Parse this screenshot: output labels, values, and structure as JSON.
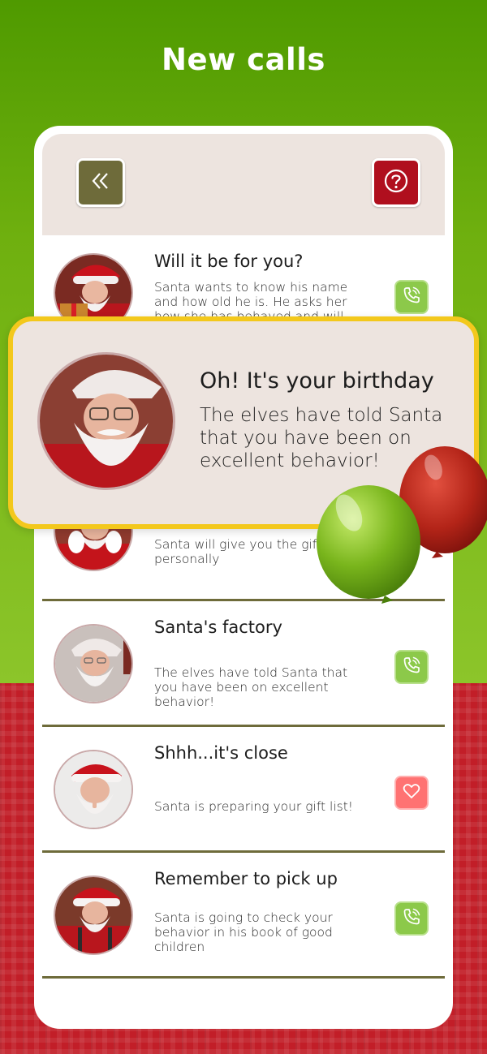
{
  "header": {
    "title": "New calls"
  },
  "toolbar": {
    "back_icon": "double-chevron-left-icon",
    "help_icon": "question-circle-icon"
  },
  "calls": [
    {
      "title": "Will it be for you?",
      "description": "Santa wants to know his name and how old he is. He asks her how she has behaved and will show him one",
      "action": "phone-call-icon"
    },
    {
      "title": "",
      "description": "Santa will give you the gifts personally",
      "action": "phone-call-icon"
    },
    {
      "title": "Santa's factory",
      "description": "The elves have told Santa that you have been on excellent behavior!",
      "action": "phone-call-icon"
    },
    {
      "title": "Shhh...it's close",
      "description": "Santa is preparing your gift list!",
      "action": "heart-icon"
    },
    {
      "title": "Remember to pick up",
      "description": "Santa is going to check your behavior in his book of good children",
      "action": "phone-call-icon"
    }
  ],
  "popup": {
    "title": "Oh! It's your birthday",
    "message": "The elves have told Santa that you have been on excellent behavior!"
  },
  "colors": {
    "green_bg": "#6fb00f",
    "red_bg": "#c21e28",
    "back_button": "#6e6b3a",
    "help_button": "#b00f1e",
    "call_button": "#8cc94a",
    "love_button": "#ff7272",
    "popup_border": "#f3c81c",
    "header_bg": "#ede4df"
  }
}
